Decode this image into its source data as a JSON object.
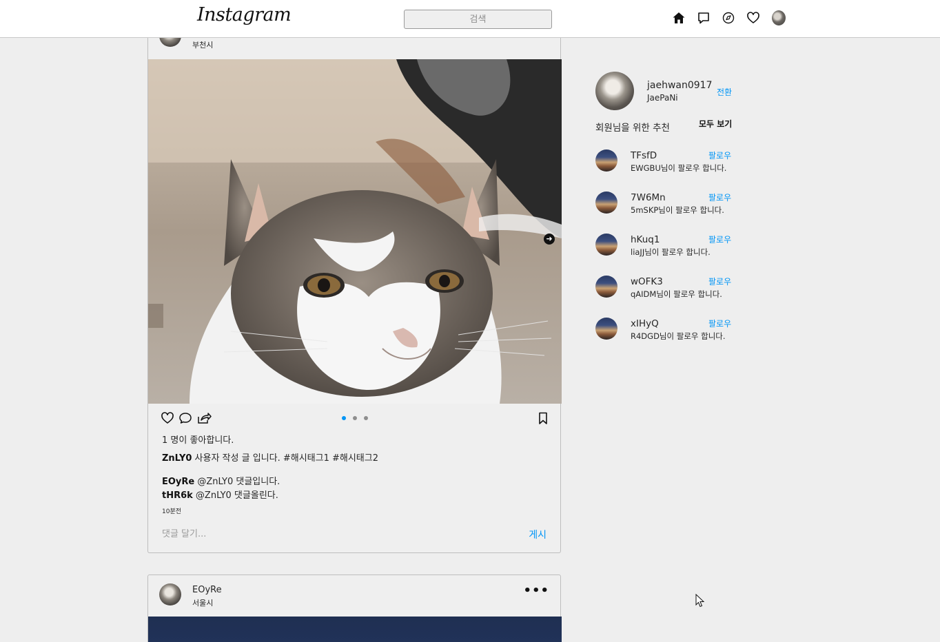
{
  "header": {
    "logo": "Instagram",
    "search_placeholder": "검색",
    "nav_icons": [
      "home-icon",
      "direct-message-icon",
      "explore-icon",
      "activity-heart-icon",
      "profile-avatar"
    ]
  },
  "feed": {
    "post1": {
      "location": "부천시",
      "image": "cat-photo",
      "carousel_pages": 3,
      "carousel_active_index": 0,
      "likes_text": "1 명이 좋아합니다.",
      "caption_user": "ZnLY0",
      "caption_text": " 사용자 작성 글 입니다. #해시태그1 #해시태그2",
      "comments": [
        {
          "user": "EOyRe",
          "text": " @ZnLY0 댓글입니다."
        },
        {
          "user": "tHR6k",
          "text": " @ZnLY0 댓글올린다."
        }
      ],
      "time": "10분전",
      "comment_placeholder": "댓글 달기...",
      "post_button": "게시"
    },
    "post2": {
      "user": "EOyRe",
      "location": "서울시"
    }
  },
  "sidebar": {
    "me": {
      "username": "jaehwan0917",
      "name": "JaePaNi",
      "switch_label": "전환"
    },
    "suggestions_title": "회원님을 위한 추천",
    "see_all": "모두 보기",
    "follow_label": "팔로우",
    "suggestions": [
      {
        "user": "TFsfD",
        "sub": "EWGBU님이 팔로우 합니다."
      },
      {
        "user": "7W6Mn",
        "sub": "5mSKP님이 팔로우 합니다."
      },
      {
        "user": "hKuq1",
        "sub": "liaJJ님이 팔로우 합니다."
      },
      {
        "user": "wOFK3",
        "sub": "qAIDM님이 팔로우 합니다."
      },
      {
        "user": "xIHyQ",
        "sub": "R4DGD님이 팔로우 합니다."
      }
    ]
  },
  "colors": {
    "accent": "#0095f6",
    "background": "#eeeeee",
    "header": "#ffffff"
  }
}
